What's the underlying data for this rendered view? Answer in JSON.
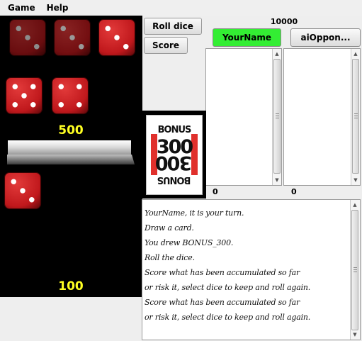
{
  "menu": {
    "items": [
      "Game",
      "Help"
    ]
  },
  "table": {
    "round_score": "500",
    "turn_score": "100",
    "kept_dice": [
      3,
      3,
      3
    ],
    "bonus_dice": [
      5,
      4
    ],
    "rolled_die": 3
  },
  "buttons": {
    "roll": "Roll dice",
    "score": "Score"
  },
  "game": {
    "target_score": "10000"
  },
  "players": [
    {
      "name": "YourName",
      "score": "0",
      "active": true,
      "color": "#33ee33"
    },
    {
      "name": "aiOppon...",
      "score": "0",
      "active": false
    }
  ],
  "card": {
    "word": "BONUS",
    "value": "300"
  },
  "log": {
    "lines": [
      "YourName, it is your turn.",
      "Draw a card.",
      "You drew BONUS_300.",
      " Roll the dice.",
      " Score what has been accumulated so far",
      "or risk it, select dice to keep and roll again.",
      " Score what has been accumulated so far",
      "or risk it, select dice to keep and roll again."
    ]
  },
  "colors": {
    "die_red": "#c0181c",
    "score_yellow": "#ffff22",
    "table": "#000000"
  }
}
